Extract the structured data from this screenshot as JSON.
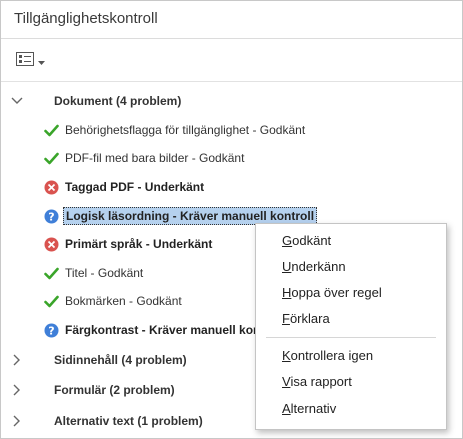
{
  "panel": {
    "title": "Tillgänglighetskontroll"
  },
  "toolbar": {
    "options_icon": "list-options-icon",
    "dropdown_icon": "caret-down-icon"
  },
  "tree": {
    "document_group": {
      "label": "Dokument (4 problem)",
      "expanded": true,
      "items": [
        {
          "label": "Behörighetsflagga för tillgänglighet - Godkänt",
          "status": "passed",
          "bold": false
        },
        {
          "label": "PDF-fil med bara bilder - Godkänt",
          "status": "passed",
          "bold": false
        },
        {
          "label": "Taggad PDF - Underkänt",
          "status": "failed",
          "bold": true
        },
        {
          "label": "Logisk läsordning - Kräver manuell kontroll",
          "status": "manual",
          "bold": true,
          "selected": true
        },
        {
          "label": "Primärt språk - Underkänt",
          "status": "failed",
          "bold": true
        },
        {
          "label": "Titel - Godkänt",
          "status": "passed",
          "bold": false
        },
        {
          "label": "Bokmärken - Godkänt",
          "status": "passed",
          "bold": false
        },
        {
          "label": "Färgkontrast - Kräver manuell kontroll",
          "status": "manual",
          "bold": true
        }
      ]
    },
    "collapsed_groups": [
      {
        "label": "Sidinnehåll (4 problem)"
      },
      {
        "label": "Formulär (2 problem)"
      },
      {
        "label": "Alternativ text (1 problem)"
      }
    ]
  },
  "context_menu": {
    "items_top": [
      {
        "mnemonic": "G",
        "rest": "odkänt"
      },
      {
        "mnemonic": "U",
        "rest": "nderkänn"
      },
      {
        "mnemonic": "H",
        "rest": "oppa över regel"
      },
      {
        "mnemonic": "F",
        "rest": "örklara"
      }
    ],
    "items_bottom": [
      {
        "mnemonic": "K",
        "rest": "ontrollera igen"
      },
      {
        "mnemonic": "V",
        "rest": "isa rapport"
      },
      {
        "mnemonic": "A",
        "rest": "lternativ"
      }
    ]
  },
  "colors": {
    "passed": "#3aa52a",
    "failed": "#d9534f",
    "manual": "#3f7fd8",
    "selection": "#b5d1ee"
  }
}
